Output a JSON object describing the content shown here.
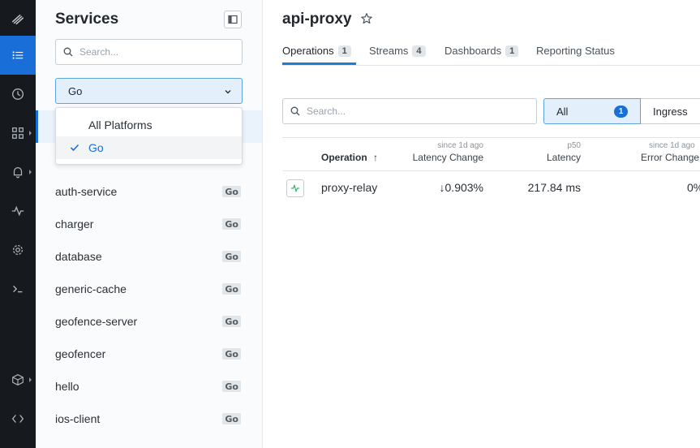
{
  "rail": {
    "items": [
      {
        "name": "logo-icon"
      },
      {
        "name": "list-icon",
        "active": true
      },
      {
        "name": "clock-icon"
      },
      {
        "name": "grid-icon"
      },
      {
        "name": "bell-icon"
      },
      {
        "name": "activity-icon"
      },
      {
        "name": "gear-icon"
      },
      {
        "name": "terminal-icon"
      },
      {
        "name": "cube-icon"
      },
      {
        "name": "code-icon"
      }
    ]
  },
  "panel": {
    "title": "Services",
    "search_placeholder": "Search...",
    "platform_selected": "Go",
    "dropdown_options": [
      "All Platforms",
      "Go"
    ],
    "services": [
      {
        "name": "auth-service",
        "platform": "Go"
      },
      {
        "name": "charger",
        "platform": "Go"
      },
      {
        "name": "database",
        "platform": "Go"
      },
      {
        "name": "generic-cache",
        "platform": "Go"
      },
      {
        "name": "geofence-server",
        "platform": "Go"
      },
      {
        "name": "geofencer",
        "platform": "Go"
      },
      {
        "name": "hello",
        "platform": "Go"
      },
      {
        "name": "ios-client",
        "platform": "Go"
      }
    ]
  },
  "main": {
    "title": "api-proxy",
    "tabs": [
      {
        "label": "Operations",
        "count": "1"
      },
      {
        "label": "Streams",
        "count": "4"
      },
      {
        "label": "Dashboards",
        "count": "1"
      },
      {
        "label": "Reporting Status",
        "count": ""
      }
    ],
    "search_placeholder": "Search...",
    "filter_all": "All",
    "filter_all_count": "1",
    "filter_ingress": "Ingress",
    "columns": {
      "operation": "Operation",
      "latency_change_sub": "since 1d ago",
      "latency_change": "Latency Change",
      "latency_sub": "p50",
      "latency": "Latency",
      "error_change_sub": "since 1d ago",
      "error_change": "Error Change"
    },
    "rows": [
      {
        "operation": "proxy-relay",
        "latency_change": "↓0.903%",
        "latency": "217.84 ms",
        "error_change": "0%"
      }
    ]
  },
  "colors": {
    "accent": "#1a6ed8",
    "rail_bg": "#16191e",
    "selected_bg": "#e3f0fb"
  }
}
